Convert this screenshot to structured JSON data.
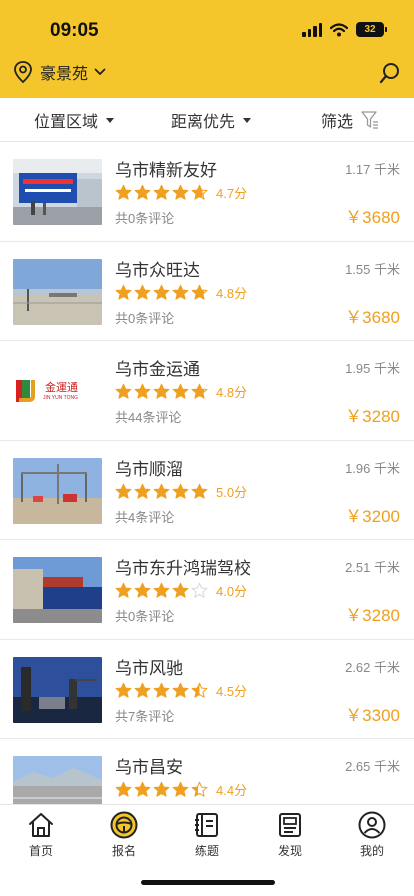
{
  "status_bar": {
    "time": "09:05",
    "battery": "32"
  },
  "location": {
    "name": "豪景苑"
  },
  "filters": [
    {
      "label": "位置区域"
    },
    {
      "label": "距离优先"
    },
    {
      "label": "筛选"
    }
  ],
  "schools": [
    {
      "name": "乌市精新友好",
      "rating": 4.7,
      "score": "4.7分",
      "reviews": "共0条评论",
      "distance": "1.17 千米",
      "price": "￥3680"
    },
    {
      "name": "乌市众旺达",
      "rating": 4.8,
      "score": "4.8分",
      "reviews": "共0条评论",
      "distance": "1.55 千米",
      "price": "￥3680"
    },
    {
      "name": "乌市金运通",
      "rating": 4.8,
      "score": "4.8分",
      "reviews": "共44条评论",
      "distance": "1.95 千米",
      "price": "￥3280",
      "logo_text": "金運通",
      "logo_sub": "JIN YUN TONG"
    },
    {
      "name": "乌市顺溜",
      "rating": 5.0,
      "score": "5.0分",
      "reviews": "共4条评论",
      "distance": "1.96 千米",
      "price": "￥3200"
    },
    {
      "name": "乌市东升鸿瑞驾校",
      "rating": 4.0,
      "score": "4.0分",
      "reviews": "共0条评论",
      "distance": "2.51 千米",
      "price": "￥3280"
    },
    {
      "name": "乌市风驰",
      "rating": 4.5,
      "score": "4.5分",
      "reviews": "共7条评论",
      "distance": "2.62 千米",
      "price": "￥3300"
    },
    {
      "name": "乌市昌安",
      "rating": 4.4,
      "score": "4.4分",
      "reviews": "",
      "distance": "2.65 千米",
      "price": ""
    }
  ],
  "tabs": [
    {
      "label": "首页",
      "icon": "home-icon"
    },
    {
      "label": "报名",
      "icon": "steering-wheel-icon"
    },
    {
      "label": "练题",
      "icon": "exercise-book-icon"
    },
    {
      "label": "发现",
      "icon": "discover-icon"
    },
    {
      "label": "我的",
      "icon": "profile-icon"
    }
  ],
  "colors": {
    "brand": "#F5C62C",
    "accent": "#F0A020",
    "star_empty": "#d8d8d8"
  }
}
